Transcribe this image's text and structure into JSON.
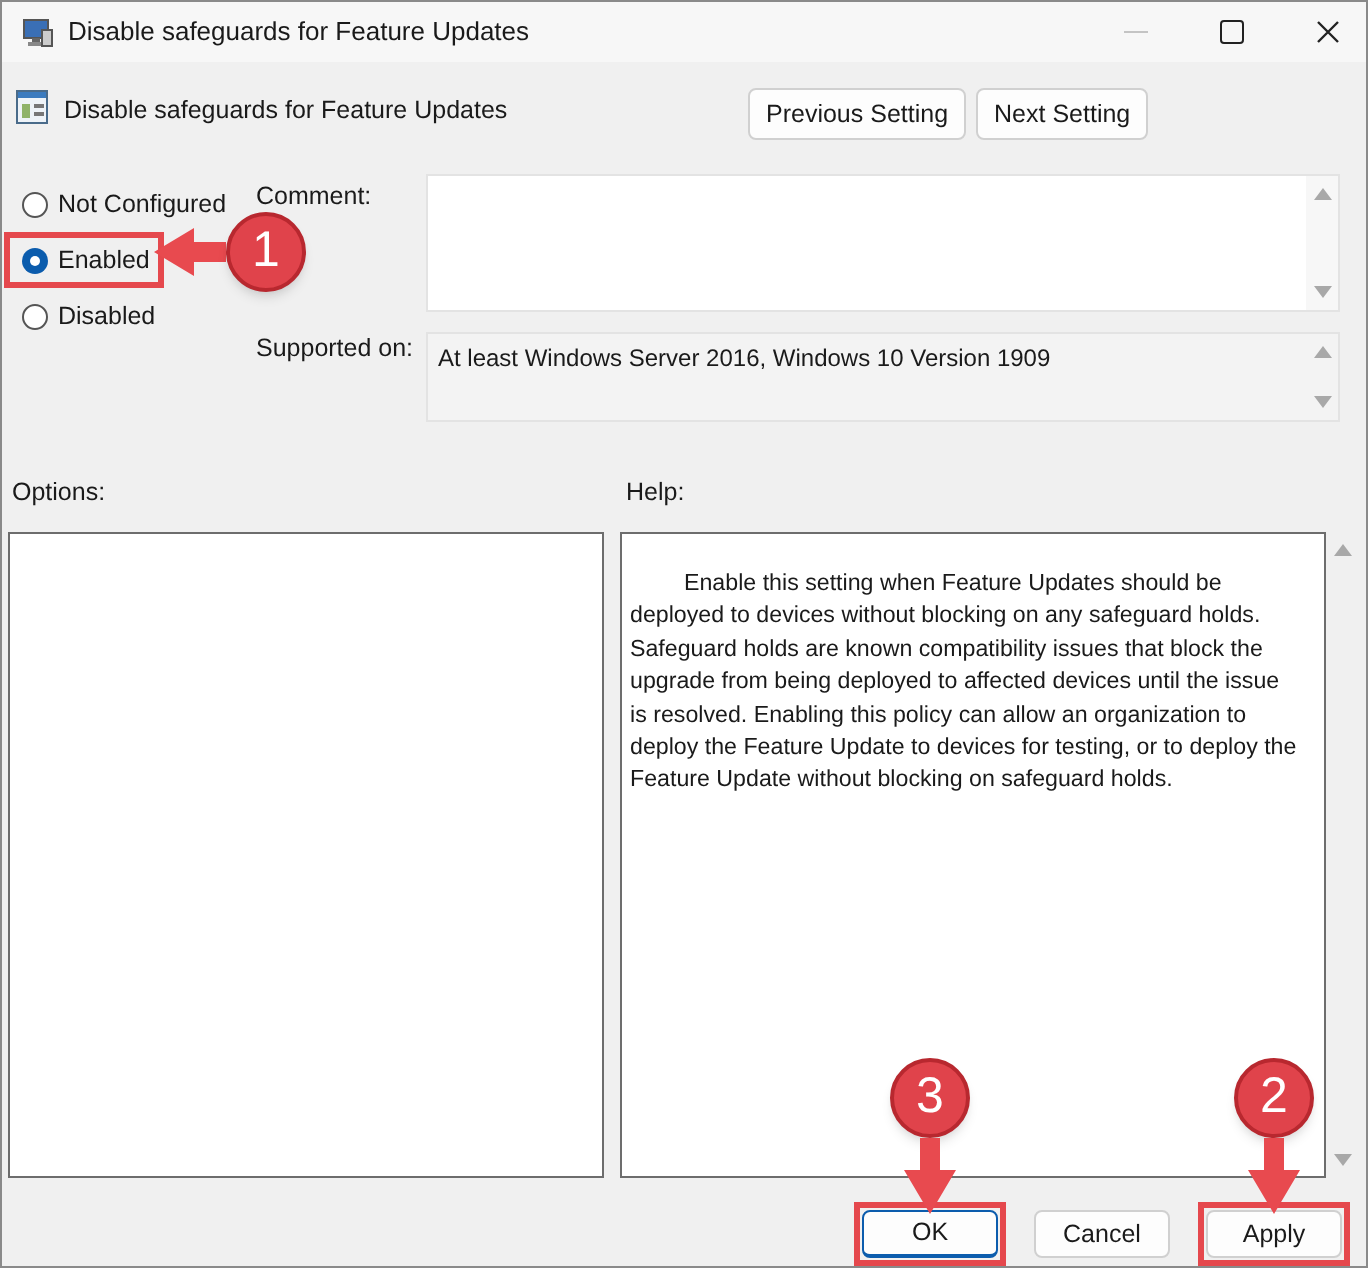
{
  "window": {
    "title": "Disable safeguards for Feature Updates"
  },
  "policy_name": "Disable safeguards for Feature Updates",
  "nav_buttons": [
    {
      "label": "Previous Setting"
    },
    {
      "label": "Next Setting"
    }
  ],
  "states": [
    {
      "label": "Not Configured",
      "selected": false,
      "highlighted": false
    },
    {
      "label": "Enabled",
      "selected": true,
      "highlighted": true,
      "callout": "1"
    },
    {
      "label": "Disabled",
      "selected": false,
      "highlighted": false
    }
  ],
  "comment": {
    "label": "Comment:"
  },
  "supported_on": {
    "label": "Supported on:",
    "value": "At least Windows Server 2016, Windows 10 Version 1909"
  },
  "options": {
    "label": "Options:"
  },
  "help": {
    "label": "Help:",
    "text": "Enable this setting when Feature Updates should be deployed to devices without blocking on any safeguard holds. Safeguard holds are known compatibility issues that block the upgrade from being deployed to affected devices until the issue is resolved. Enabling this policy can allow an organization to deploy the Feature Update to devices for testing, or to deploy the Feature Update without blocking on safeguard holds."
  },
  "buttons": [
    {
      "label": "OK",
      "default": true,
      "highlighted": true,
      "callout": "3"
    },
    {
      "label": "Cancel",
      "default": false,
      "highlighted": false
    },
    {
      "label": "Apply",
      "default": false,
      "highlighted": true,
      "callout": "2"
    }
  ]
}
